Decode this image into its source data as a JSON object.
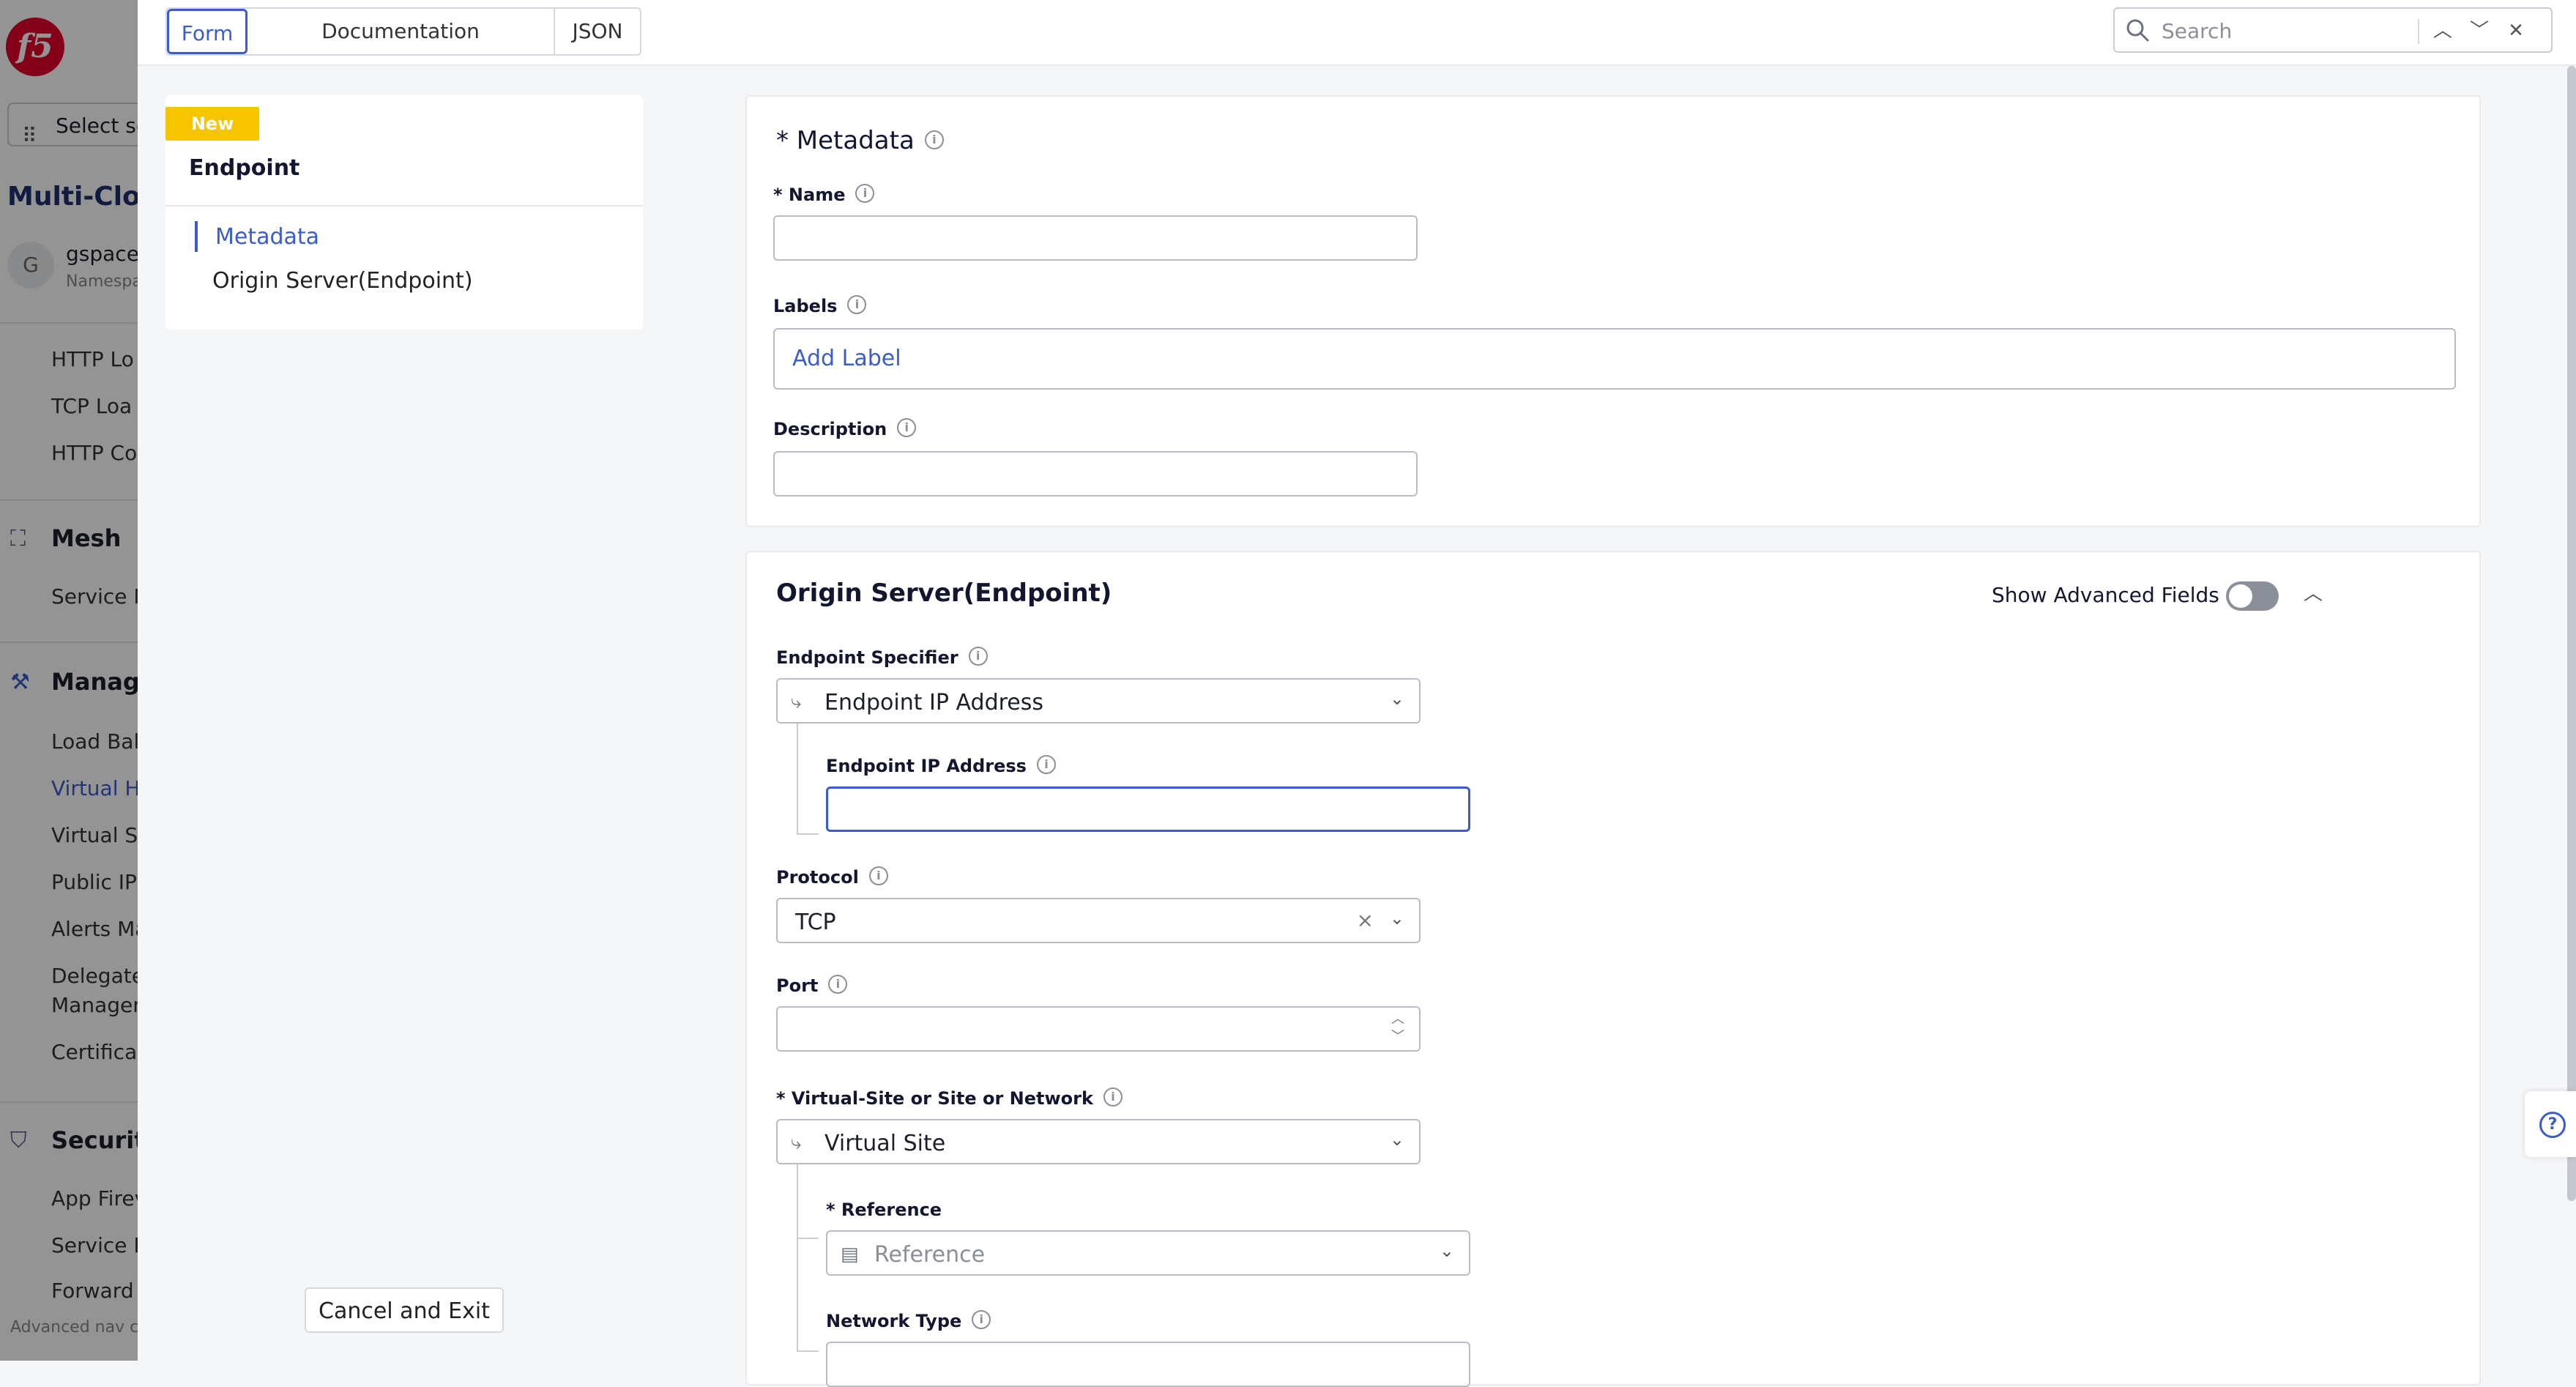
{
  "bgnav": {
    "select_label": "Select se",
    "title": "Multi-Clou",
    "avatar_letter": "G",
    "namespace": "gspace",
    "namespace_sub": "Namespa",
    "items_top": [
      "HTTP Lo",
      "TCP Loa",
      "HTTP Co"
    ],
    "section_mesh": "Mesh",
    "mesh_items": [
      "Service M"
    ],
    "section_manage": "Manage",
    "manage_items": [
      "Load Bala",
      "Virtual H",
      "Virtual Si",
      "Public IP",
      "Alerts Ma",
      "Delegate",
      "Managem",
      "Certifica"
    ],
    "section_security": "Security",
    "security_items": [
      "App Firev",
      "Service F",
      "Forward"
    ],
    "footer": "Advanced nav c"
  },
  "topbar": {
    "tabs": [
      "Form",
      "Documentation",
      "JSON"
    ],
    "active_tab": "Form",
    "search_placeholder": "Search"
  },
  "steps": {
    "badge": "New",
    "header": "Endpoint",
    "items": [
      "Metadata",
      "Origin Server(Endpoint)"
    ],
    "active": "Metadata",
    "cancel_label": "Cancel and Exit"
  },
  "metadata": {
    "title": "* Metadata",
    "name_label": "* Name",
    "name_value": "",
    "labels_label": "Labels",
    "add_label": "Add Label",
    "description_label": "Description",
    "description_value": ""
  },
  "origin": {
    "title": "Origin Server(Endpoint)",
    "show_advanced_label": "Show Advanced Fields",
    "show_advanced_on": false,
    "endpoint_specifier_label": "Endpoint Specifier",
    "endpoint_specifier_value": "Endpoint IP Address",
    "endpoint_ip_label": "Endpoint IP Address",
    "endpoint_ip_value": "",
    "protocol_label": "Protocol",
    "protocol_value": "TCP",
    "port_label": "Port",
    "port_value": "",
    "vsite_label": "* Virtual-Site or Site or Network",
    "vsite_value": "Virtual Site",
    "reference_label": "* Reference",
    "reference_placeholder": "Reference",
    "network_type_label": "Network Type"
  },
  "icons": {
    "info": "info-icon",
    "chevron": "chevron-down-icon",
    "branch": "branch-icon",
    "reference": "reference-icon",
    "help": "help-icon"
  },
  "colors": {
    "accent": "#3a5ccc",
    "badge": "#f7c400",
    "brand": "#e4002b"
  }
}
